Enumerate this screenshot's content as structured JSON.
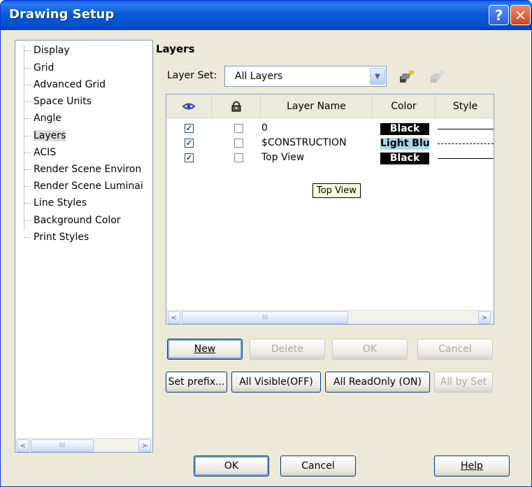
{
  "window": {
    "title": "Drawing Setup",
    "help_glyph": "?",
    "close_glyph": "✕"
  },
  "tree": {
    "items": [
      {
        "label": "Display"
      },
      {
        "label": "Grid"
      },
      {
        "label": "Advanced Grid"
      },
      {
        "label": "Space Units"
      },
      {
        "label": "Angle"
      },
      {
        "label": "Layers"
      },
      {
        "label": "ACIS"
      },
      {
        "label": "Render Scene Environ"
      },
      {
        "label": "Render Scene Luminai"
      },
      {
        "label": "Line Styles"
      },
      {
        "label": "Background Color"
      },
      {
        "label": "Print Styles"
      }
    ],
    "selected_index": 5
  },
  "panel": {
    "title": "Layers",
    "layer_set_label": "Layer Set:",
    "layer_set_value": "All Layers"
  },
  "grid": {
    "headers": {
      "name": "Layer Name",
      "color": "Color",
      "style": "Style"
    },
    "rows": [
      {
        "visible": true,
        "readonly": false,
        "name": "0",
        "color": "Black",
        "style": "solid"
      },
      {
        "visible": true,
        "readonly": false,
        "name": "$CONSTRUCTION",
        "color": "Light Blu",
        "style": "dashdot"
      },
      {
        "visible": true,
        "readonly": false,
        "name": "Top View",
        "color": "Black",
        "style": "solid"
      }
    ],
    "tooltip": "Top View"
  },
  "buttons": {
    "new": "New",
    "delete": "Delete",
    "ok_row": "OK",
    "cancel_row": "Cancel",
    "set_prefix": "Set prefix...",
    "all_visible": "All Visible(OFF)",
    "all_readonly": "All ReadOnly (ON)",
    "all_by_set": "All by Set",
    "ok": "OK",
    "cancel": "Cancel",
    "help": "Help"
  },
  "scroll_glyphs": {
    "left": "<",
    "right": ">",
    "thumb": "III"
  }
}
